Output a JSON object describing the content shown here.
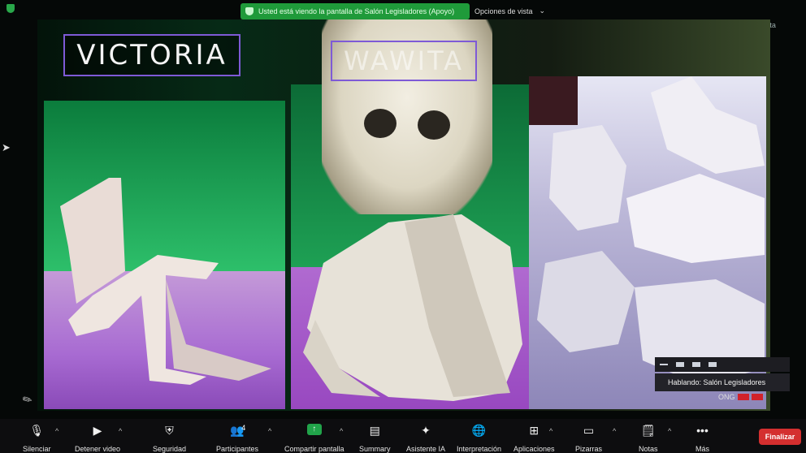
{
  "banner": {
    "share_notice": "Usted está viendo la pantalla de Salón Legisladores (Apoyo)",
    "view_options": "Opciones de vista",
    "view_label": "Vista"
  },
  "slide": {
    "title_left": "VICTORIA",
    "title_middle": "WAWITA"
  },
  "speaker": {
    "label": "Hablando: Salón Legisladores",
    "name_tag": "ONG"
  },
  "toolbar": {
    "items": [
      {
        "label": "Silenciar",
        "icon": "microphone-icon"
      },
      {
        "label": "Detener video",
        "icon": "video-camera-icon"
      },
      {
        "label": "Seguridad",
        "icon": "shield-icon"
      },
      {
        "label": "Participantes",
        "icon": "participants-icon",
        "count": "4"
      },
      {
        "label": "Compartir pantalla",
        "icon": "share-screen-icon"
      },
      {
        "label": "Summary",
        "icon": "summary-icon"
      },
      {
        "label": "Asistente IA",
        "icon": "ai-sparkle-icon"
      },
      {
        "label": "Interpretación",
        "icon": "globe-icon"
      },
      {
        "label": "Aplicaciones",
        "icon": "apps-icon"
      },
      {
        "label": "Pizarras",
        "icon": "whiteboard-icon"
      },
      {
        "label": "Notas",
        "icon": "notes-icon"
      },
      {
        "label": "Más",
        "icon": "more-icon"
      }
    ],
    "end_label": "Finalizar"
  },
  "colors": {
    "share_green": "#1f9a3a",
    "end_red": "#d42f2f",
    "title_border": "#7e5ad6"
  }
}
